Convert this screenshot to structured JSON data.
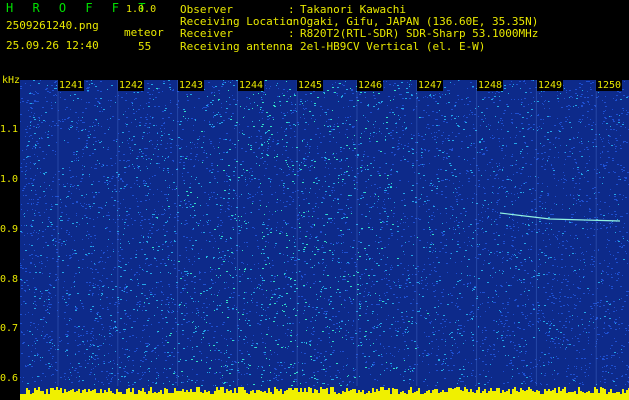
{
  "header": {
    "app_title": "H R O F F T",
    "version": "1.0.0",
    "filename": "2509261240.png",
    "timestamp": "25.09.26 12:40",
    "meteor_label": "meteor",
    "meteor_count": "55",
    "info": [
      {
        "key": "Observer",
        "value": "Takanori Kawachi"
      },
      {
        "key": "Receiving Location",
        "value": "Ogaki, Gifu, JAPAN (136.60E, 35.35N)"
      },
      {
        "key": "Receiver",
        "value": "R820T2(RTL-SDR) SDR-Sharp 53.1000MHz"
      },
      {
        "key": "Receiving antenna",
        "value": "2el-HB9CV Vertical (el. E-W)"
      }
    ]
  },
  "spectrogram": {
    "y_unit": "kHz",
    "y_ticks": [
      "1.1",
      "1.0",
      "0.9",
      "0.8",
      "0.7",
      "0.6"
    ],
    "x_ticks": [
      "1241",
      "1242",
      "1243",
      "1244",
      "1245",
      "1246",
      "1247",
      "1248",
      "1249",
      "1250"
    ],
    "colors": {
      "background": "#0d2a8a",
      "noise_low": "#1d4fd0",
      "noise_mid": "#22a6e8",
      "noise_high": "#30e0c8",
      "bottom_band": "#f0f000",
      "labels": "#e8e800"
    }
  }
}
